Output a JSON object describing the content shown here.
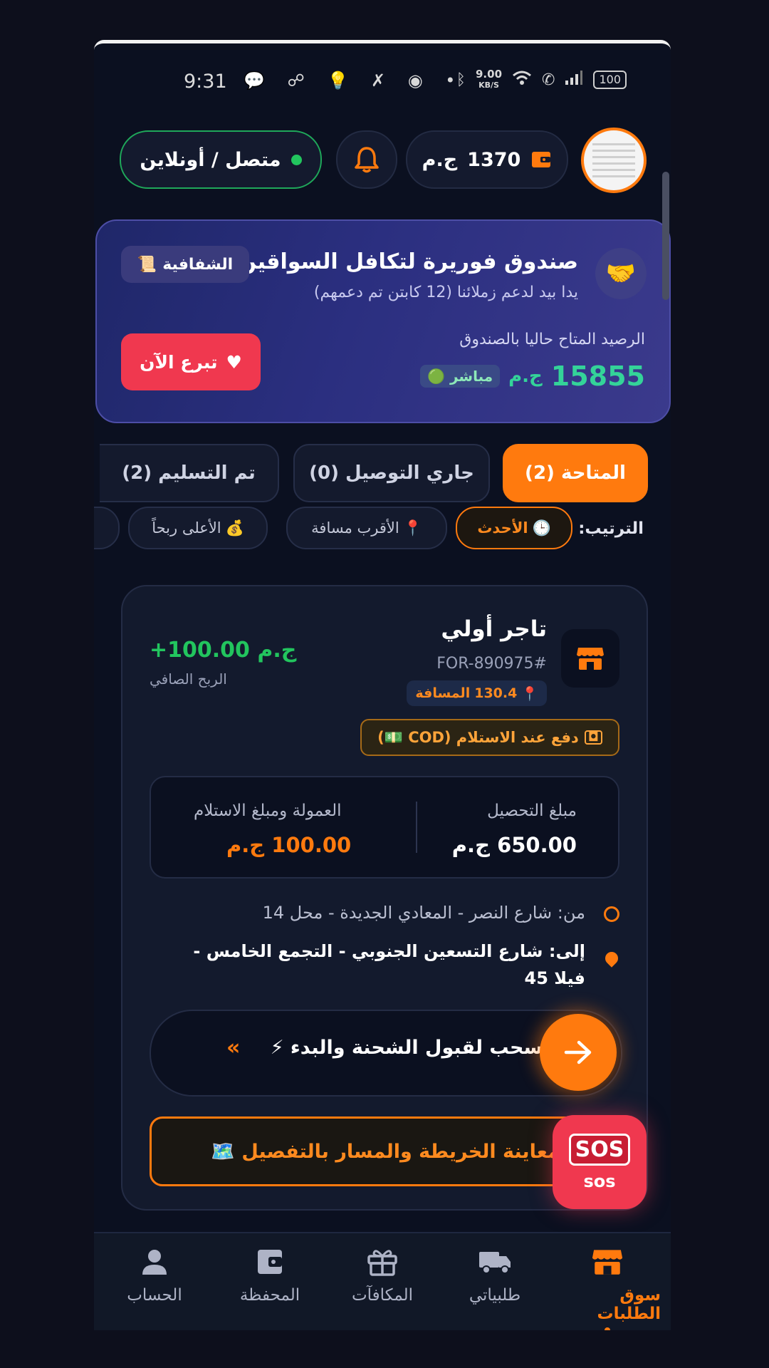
{
  "status_bar": {
    "time": "9:31",
    "net_speed": "9.00",
    "net_unit": "KB/S",
    "battery": "100"
  },
  "header": {
    "online_label": "متصل / أونلاين",
    "wallet_amount": "1370",
    "wallet_currency": "ج.م"
  },
  "fund": {
    "title": "صندوق فوريرة لتكافل السواقين",
    "subtitle": "يدا بيد لدعم زملائنا (12 كابتن تم دعمهم)",
    "transparency_label": "الشفافية",
    "balance_label": "الرصيد المتاح حاليا بالصندوق",
    "balance_value": "15855",
    "balance_currency": "ج.م",
    "live_label": "مباشر",
    "donate_label": "تبرع الآن"
  },
  "tabs": [
    {
      "label": "المتاحة (2)",
      "active": true
    },
    {
      "label": "جاري التوصيل (0)",
      "active": false
    },
    {
      "label": "تم التسليم (2)",
      "active": false
    }
  ],
  "sort": {
    "label": "الترتيب:",
    "options": [
      {
        "label": "الأحدث",
        "icon": "clock-icon",
        "active": true
      },
      {
        "label": "الأقرب مسافة",
        "icon": "pin-icon",
        "active": false
      },
      {
        "label": "الأعلى ربحاً",
        "icon": "money-bag-icon",
        "active": false
      }
    ]
  },
  "order": {
    "merchant": "تاجر أولي",
    "order_id": "FOR-890975#",
    "distance_value": "130.4",
    "distance_label": "المسافة",
    "profit_value": "+100.00",
    "profit_currency": "ج.م",
    "profit_label": "الربح الصافي",
    "cod_label": "دفع عند الاستلام (COD 💵)",
    "collect_label": "مبلغ التحصيل",
    "collect_value": "650.00 ج.م",
    "commission_label": "العمولة ومبلغ الاستلام",
    "commission_value": "100.00 ج.م",
    "from": "من: شارع النصر - المعادي الجديدة - محل 14",
    "to_line1": "إلى: شارع التسعين الجنوبي - التجمع الخامس -",
    "to_line2": "فيلا 45",
    "swipe_label": "سحب لقبول الشحنة والبدء ⚡",
    "swipe_arrows": "«",
    "map_label": "معاينة الخريطة والمسار بالتفصيل 🗺️"
  },
  "sos": {
    "icon_text": "SOS",
    "label": "sos"
  },
  "nav": [
    {
      "label": "سوق الطلبات",
      "icon": "store-icon",
      "active": true
    },
    {
      "label": "طلبياتي",
      "icon": "truck-icon",
      "active": false
    },
    {
      "label": "المكافآت",
      "icon": "gift-icon",
      "active": false
    },
    {
      "label": "المحفظة",
      "icon": "wallet-icon",
      "active": false
    },
    {
      "label": "الحساب",
      "icon": "user-icon",
      "active": false
    }
  ],
  "colors": {
    "accent": "#ff7a0e",
    "success": "#22c55e",
    "danger": "#f0384f",
    "background": "#0b1020"
  }
}
